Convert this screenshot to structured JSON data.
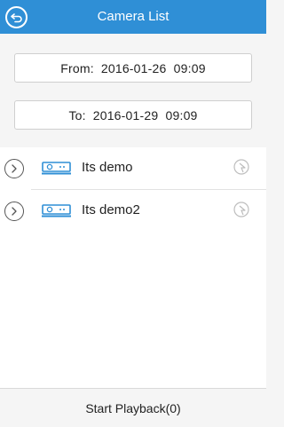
{
  "header": {
    "title": "Camera List"
  },
  "time_range": {
    "from_label": "From:",
    "from_value": "2016-01-26  09:09",
    "to_label": "To:",
    "to_value": "2016-01-29  09:09"
  },
  "cameras": [
    {
      "name": "Its demo"
    },
    {
      "name": "Its demo2"
    }
  ],
  "footer": {
    "playback_label": "Start Playback(0)"
  },
  "colors": {
    "header_bg": "#2f8fd6",
    "camera_icon": "#2f8fd6",
    "background": "#f5f5f5"
  }
}
